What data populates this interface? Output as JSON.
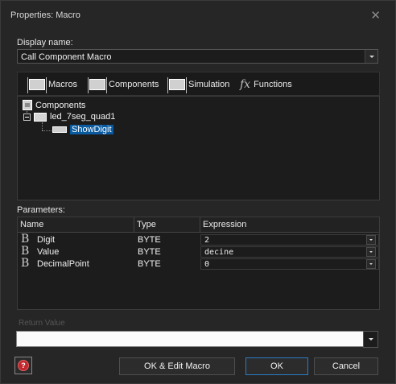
{
  "window": {
    "title": "Properties: Macro"
  },
  "display_name": {
    "label": "Display name:",
    "value": "Call Component Macro"
  },
  "tabs": [
    {
      "label": "Macros",
      "icon": "chip-icon"
    },
    {
      "label": "Components",
      "icon": "chip-icon"
    },
    {
      "label": "Simulation",
      "icon": "chip-icon"
    },
    {
      "label": "Functions",
      "icon": "fx-icon"
    }
  ],
  "tree": {
    "root": "Components",
    "child": "led_7seg_quad1",
    "leaf": "ShowDigit"
  },
  "parameters": {
    "label": "Parameters:",
    "columns": [
      "Name",
      "Type",
      "Expression"
    ],
    "rows": [
      {
        "name": "Digit",
        "type": "BYTE",
        "expression": "2"
      },
      {
        "name": "Value",
        "type": "BYTE",
        "expression": "decine"
      },
      {
        "name": "DecimalPoint",
        "type": "BYTE",
        "expression": "0"
      }
    ]
  },
  "return_value": {
    "label": "Return Value",
    "value": ""
  },
  "buttons": {
    "ok_edit": "OK & Edit Macro",
    "ok": "OK",
    "cancel": "Cancel",
    "help_glyph": "?"
  },
  "colors": {
    "selection": "#0a5aa0",
    "default_button_border": "#2d7cc4",
    "help_icon": "#c1272d"
  }
}
